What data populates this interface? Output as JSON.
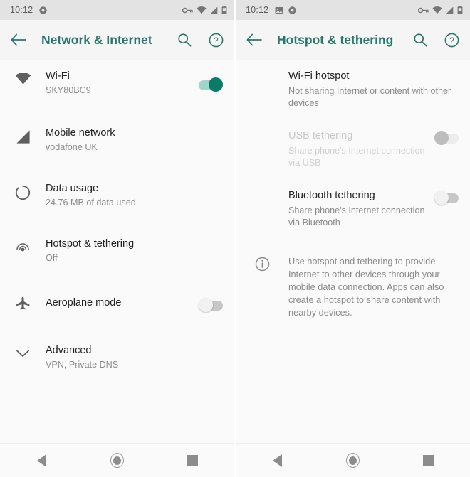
{
  "colors": {
    "accent": "#27786a",
    "toggle_on_thumb": "#0c7a68",
    "toggle_on_track": "#9fd5cb",
    "background": "#fafafa",
    "statusbar": "#e3e3e3",
    "appbar": "#f5f5f5",
    "title_text": "#212121",
    "subtitle_text": "#8a8a8a",
    "disabled_text": "#c8c8c8"
  },
  "left_screen": {
    "statusbar": {
      "time": "10:12",
      "left_icons": [
        "record-dot-icon"
      ],
      "right_icons": [
        "vpn-key-icon",
        "wifi-icon",
        "mobile-signal-icon",
        "battery-icon"
      ]
    },
    "appbar": {
      "back_label": "back-arrow",
      "title": "Network & Internet",
      "search_label": "Search",
      "help_label": "Help"
    },
    "items": [
      {
        "icon": "wifi-icon",
        "title": "Wi-Fi",
        "subtitle": "SKY80BC9",
        "toggle": "on",
        "has_divider": true
      },
      {
        "icon": "mobile-signal-icon",
        "title": "Mobile network",
        "subtitle": "vodafone UK",
        "toggle": "none",
        "has_divider": false
      },
      {
        "icon": "data-usage-icon",
        "title": "Data usage",
        "subtitle": "24.76 MB of data used",
        "toggle": "none",
        "has_divider": false
      },
      {
        "icon": "hotspot-icon",
        "title": "Hotspot & tethering",
        "subtitle": "Off",
        "toggle": "none",
        "has_divider": false
      },
      {
        "icon": "aeroplane-icon",
        "title": "Aeroplane mode",
        "subtitle": "",
        "toggle": "off",
        "has_divider": false
      },
      {
        "icon": "chevron-down-icon",
        "title": "Advanced",
        "subtitle": "VPN, Private DNS",
        "toggle": "none",
        "has_divider": false
      }
    ],
    "navbar": [
      "back-icon",
      "home-icon",
      "recents-icon"
    ]
  },
  "right_screen": {
    "statusbar": {
      "time": "10:12",
      "left_icons": [
        "screenshot-image-icon",
        "record-dot-icon"
      ],
      "right_icons": [
        "vpn-key-icon",
        "wifi-icon",
        "mobile-signal-icon",
        "battery-icon"
      ]
    },
    "appbar": {
      "back_label": "back-arrow",
      "title": "Hotspot & tethering",
      "search_label": "Search",
      "help_label": "Help"
    },
    "prefs": [
      {
        "title": "Wi-Fi hotspot",
        "subtitle": "Not sharing Internet or content with other devices",
        "toggle": "none",
        "enabled": true
      },
      {
        "title": "USB tethering",
        "subtitle": "Share phone's Internet connection via USB",
        "toggle": "disabled",
        "enabled": false
      },
      {
        "title": "Bluetooth tethering",
        "subtitle": "Share phone's Internet connection via Bluetooth",
        "toggle": "off",
        "enabled": true
      }
    ],
    "info": {
      "icon": "info-icon",
      "text": "Use hotspot and tethering to provide Internet to other devices through your mobile data connection. Apps can also create a hotspot to share content with nearby devices."
    },
    "navbar": [
      "back-icon",
      "home-icon",
      "recents-icon"
    ]
  }
}
